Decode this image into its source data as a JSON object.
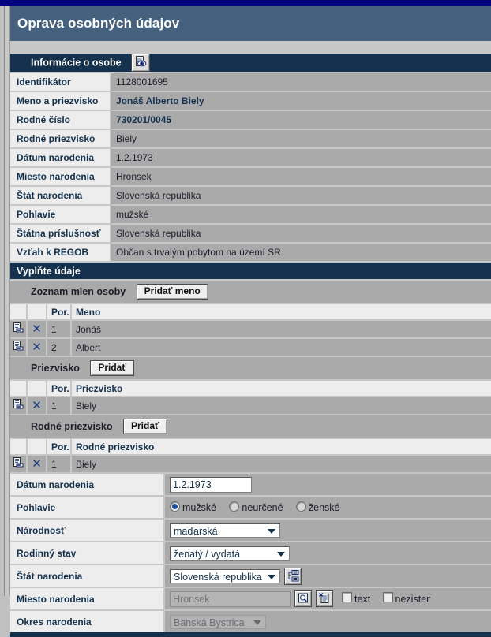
{
  "window": {
    "title": "Oprava osobných údajov"
  },
  "person_info": {
    "section_title": "Informácie o osobe",
    "detail_icon": "document-eye-icon",
    "rows": [
      {
        "label": "Identifikátor",
        "value": "1128001695",
        "bold": false
      },
      {
        "label": "Meno a priezvisko",
        "value": "Jonáš Alberto  Biely",
        "bold": true
      },
      {
        "label": "Rodné číslo",
        "value": "730201/0045",
        "bold": true
      },
      {
        "label": "Rodné priezvisko",
        "value": "Biely",
        "bold": false
      },
      {
        "label": "Dátum narodenia",
        "value": "1.2.1973",
        "bold": false
      },
      {
        "label": "Miesto narodenia",
        "value": "Hronsek",
        "bold": false
      },
      {
        "label": "Štát narodenia",
        "value": "Slovenská republika",
        "bold": false
      },
      {
        "label": "Pohlavie",
        "value": "mužské",
        "bold": false
      },
      {
        "label": "Štátna príslušnosť",
        "value": "Slovenská republika",
        "bold": false
      },
      {
        "label": "Vzťah k REGOB",
        "value": "Občan s trvalým pobytom na území SR",
        "bold": false
      }
    ]
  },
  "fill_section": {
    "title": "Vyplňte údaje"
  },
  "names_list": {
    "title": "Zoznam mien osoby",
    "add_button": "Pridať meno",
    "columns": [
      "",
      "",
      "Por.",
      "Meno"
    ],
    "rows": [
      {
        "edit_icon": "edit-row-icon",
        "delete_icon": "delete-row-icon",
        "order": "1",
        "name": "Jonáš"
      },
      {
        "edit_icon": "edit-row-icon",
        "delete_icon": "delete-row-icon",
        "order": "2",
        "name": "Albert"
      }
    ]
  },
  "surname_list": {
    "title": "Priezvisko",
    "add_button": "Pridať",
    "columns": [
      "",
      "",
      "Por.",
      "Priezvisko"
    ],
    "rows": [
      {
        "edit_icon": "edit-row-icon",
        "delete_icon": "delete-row-icon",
        "order": "1",
        "name": "Biely"
      }
    ]
  },
  "birth_surname_list": {
    "title": "Rodné priezvisko",
    "add_button": "Pridať",
    "columns": [
      "",
      "",
      "Por.",
      "Rodné priezvisko"
    ],
    "rows": [
      {
        "edit_icon": "edit-row-icon",
        "delete_icon": "delete-row-icon",
        "order": "1",
        "name": "Biely"
      }
    ]
  },
  "form": {
    "birth_date": {
      "label": "Dátum narodenia",
      "value": "1.2.1973"
    },
    "gender": {
      "label": "Pohlavie",
      "options": [
        {
          "label": "mužské",
          "selected": true
        },
        {
          "label": "neurčené",
          "selected": false
        },
        {
          "label": "ženské",
          "selected": false
        }
      ]
    },
    "nationality": {
      "label": "Národnosť",
      "value": "maďarská"
    },
    "marital_status": {
      "label": "Rodinný stav",
      "value": "ženatý / vydatá"
    },
    "birth_country": {
      "label": "Štát narodenia",
      "value": "Slovenská republika",
      "side_icon": "list-select-icon"
    },
    "birth_place": {
      "label": "Miesto narodenia",
      "placeholder": "Hronsek",
      "value": "",
      "search_icon": "search-magnifier-icon",
      "pick_icon": "document-pick-icon",
      "checkboxes": [
        {
          "label": "text",
          "checked": false
        },
        {
          "label": "nezistené",
          "checked": false
        }
      ]
    },
    "birth_district": {
      "label": "Okres narodenia",
      "value": "Banská Bystrica",
      "readonly": true
    }
  },
  "colors": {
    "titlebar": "#46617d",
    "section_header": "#14314e",
    "row_value_bg": "#aaaaab",
    "row_label_bg": "#ededed",
    "page_bg": "#c0c0c0",
    "accent_blue": "#1b4f9c",
    "top_strip": "#000080"
  }
}
